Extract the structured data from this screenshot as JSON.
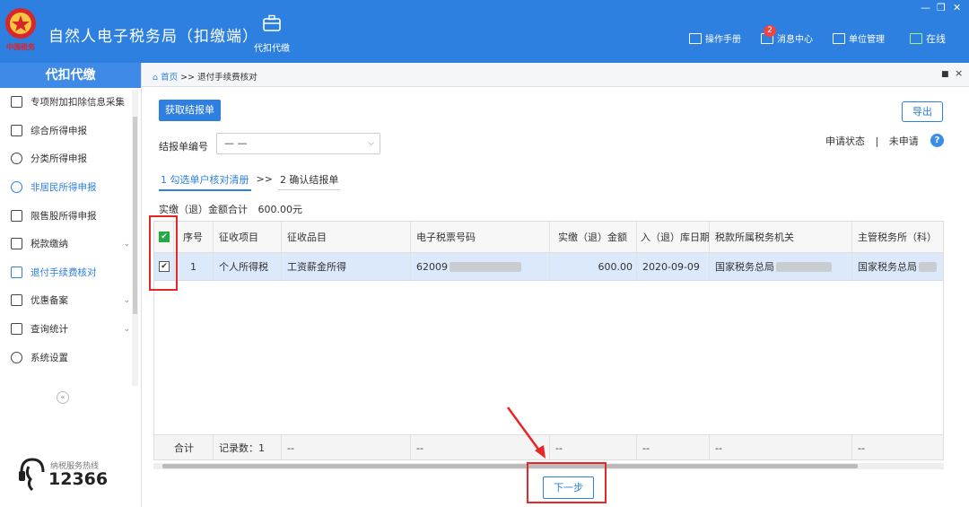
{
  "app": {
    "title": "自然人电子税务局（扣缴端）",
    "module_label": "代扣代缴"
  },
  "header_links": [
    {
      "label": "操作手册",
      "icon": "manual-icon"
    },
    {
      "label": "消息中心",
      "icon": "mail-icon",
      "badge": "2"
    },
    {
      "label": "单位管理",
      "icon": "building-icon"
    },
    {
      "label": "在线",
      "icon": "monitor-icon"
    }
  ],
  "window_controls": {
    "minimize": "—",
    "restore": "❐",
    "close": "✕"
  },
  "sidebar": {
    "title": "代扣代缴",
    "items": [
      {
        "label": "专项附加扣除信息采集",
        "icon": "list-icon"
      },
      {
        "label": "综合所得申报",
        "icon": "layers-icon"
      },
      {
        "label": "分类所得申报",
        "icon": "pie-icon"
      },
      {
        "label": "非居民所得申报",
        "icon": "person-icon",
        "active": true
      },
      {
        "label": "限售股所得申报",
        "icon": "bar-chart-icon"
      },
      {
        "label": "税款缴纳",
        "icon": "folder-icon",
        "chevron": true
      },
      {
        "label": "退付手续费核对",
        "icon": "document-icon",
        "active": true
      },
      {
        "label": "优惠备案",
        "icon": "file-icon",
        "chevron": true
      },
      {
        "label": "查询统计",
        "icon": "query-icon",
        "chevron": true
      },
      {
        "label": "系统设置",
        "icon": "gear-icon"
      }
    ],
    "collapse": "«",
    "hotline_label": "纳税服务热线",
    "hotline_number": "12366"
  },
  "breadcrumb": {
    "home": "首页",
    "sep": ">>",
    "current": "退付手续费核对"
  },
  "tab_controls": {
    "pin": "■",
    "close": "×"
  },
  "toolbar": {
    "get_report": "获取结报单",
    "export": "导出"
  },
  "report_no": {
    "label": "结报单编号",
    "value": "— —"
  },
  "apply_status": {
    "label": "申请状态",
    "sep": "|",
    "value": "未申请",
    "help": "?"
  },
  "steps": {
    "step1": "1 勾选单户核对清册",
    "arrow": ">>",
    "step2": "2 确认结报单"
  },
  "summary": {
    "label": "实缴（退）金额合计",
    "value": "600.00元"
  },
  "table": {
    "columns": [
      "序号",
      "征收项目",
      "征收品目",
      "电子税票号码",
      "实缴（退）金额",
      "入（退）库日期",
      "税款所属税务机关",
      "主管税务所（科）"
    ],
    "rows": [
      {
        "checked": true,
        "cells": [
          "1",
          "个人所得税",
          "工资薪金所得",
          "62009",
          "600.00",
          "2020-09-09",
          "国家税务总局",
          "国家税务总局"
        ]
      }
    ],
    "footer": [
      "合计",
      "记录数：1",
      "--",
      "--",
      "--",
      "--",
      "--",
      "--"
    ]
  },
  "next_button": "下一步",
  "colors": {
    "header": "#2d7fe0",
    "highlight": "#e52727",
    "row_selected": "#dce9fb"
  }
}
